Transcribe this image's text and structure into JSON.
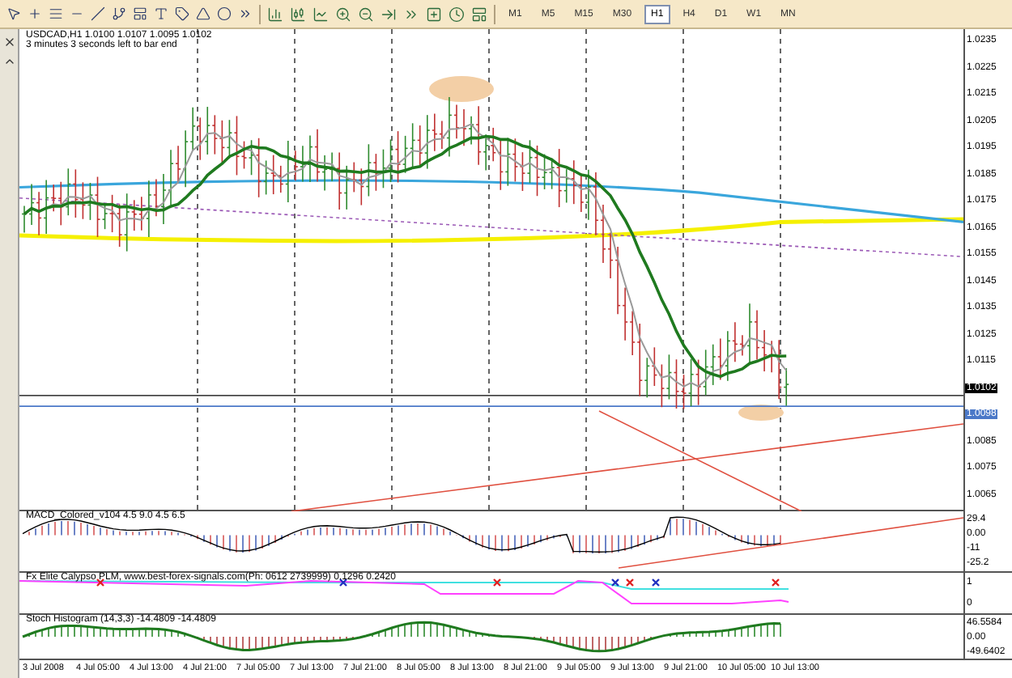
{
  "toolbar": {
    "timeframes": [
      {
        "label": "M1",
        "selected": false
      },
      {
        "label": "M5",
        "selected": false
      },
      {
        "label": "M15",
        "selected": false
      },
      {
        "label": "M30",
        "selected": false
      },
      {
        "label": "H1",
        "selected": true
      },
      {
        "label": "H4",
        "selected": false
      },
      {
        "label": "D1",
        "selected": false
      },
      {
        "label": "W1",
        "selected": false
      },
      {
        "label": "MN",
        "selected": false
      }
    ]
  },
  "chart": {
    "symbol_line": "USDCAD,H1  1.0100 1.0107 1.0095 1.0102",
    "timer": "3 minutes 3 seconds left to bar end",
    "price_axis": [
      {
        "label": "1.0235",
        "kind": "tick"
      },
      {
        "label": "1.0225",
        "kind": "tick"
      },
      {
        "label": "1.0215",
        "kind": "tick"
      },
      {
        "label": "1.0205",
        "kind": "tick"
      },
      {
        "label": "1.0195",
        "kind": "tick"
      },
      {
        "label": "1.0185",
        "kind": "tick"
      },
      {
        "label": "1.0175",
        "kind": "tick"
      },
      {
        "label": "1.0165",
        "kind": "tick"
      },
      {
        "label": "1.0155",
        "kind": "tick"
      },
      {
        "label": "1.0145",
        "kind": "tick"
      },
      {
        "label": "1.0135",
        "kind": "tick"
      },
      {
        "label": "1.0125",
        "kind": "tick"
      },
      {
        "label": "1.0115",
        "kind": "tick"
      },
      {
        "label": "1.0102",
        "kind": "bid"
      },
      {
        "label": "1.0098",
        "kind": "line"
      },
      {
        "label": "1.0085",
        "kind": "tick"
      },
      {
        "label": "1.0075",
        "kind": "tick"
      },
      {
        "label": "1.0065",
        "kind": "tick"
      }
    ]
  },
  "indicators": [
    {
      "kind": "macd",
      "name": "MACD_Colored_v104 4.5 9.0 4.5 6.5",
      "scale": [
        "29.4",
        "0.00",
        "-11",
        "-25.2"
      ]
    },
    {
      "kind": "calypso",
      "name": "Fx Elite Calypso PLM, www.best-forex-signals.com(Ph: 0612 2739999) 0.1296 0.2420",
      "scale": [
        "1",
        "0"
      ]
    },
    {
      "kind": "stoch",
      "name": "Stoch Histogram (14,3,3) -14.4809 -14.4809",
      "scale": [
        "46.5584",
        "0.00",
        "-49.6402"
      ]
    }
  ],
  "time_axis": [
    "3 Jul 2008",
    "4 Jul 05:00",
    "4 Jul 13:00",
    "4 Jul 21:00",
    "7 Jul 05:00",
    "7 Jul 13:00",
    "7 Jul 21:00",
    "8 Jul 05:00",
    "8 Jul 13:00",
    "8 Jul 21:00",
    "9 Jul 05:00",
    "9 Jul 13:00",
    "9 Jul 21:00",
    "10 Jul 05:00",
    "10 Jul 13:00"
  ]
}
